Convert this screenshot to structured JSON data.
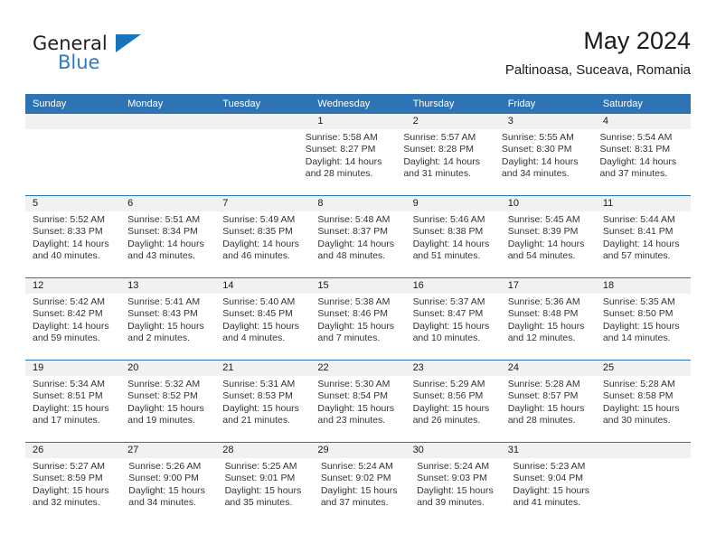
{
  "brand": {
    "name_top": "General",
    "name_bottom": "Blue",
    "triangle_color": "#1874bb",
    "text_color": "#231f20",
    "blue_text_color": "#2b7cc0"
  },
  "header": {
    "title": "May 2024",
    "subtitle": "Paltinoasa, Suceava, Romania"
  },
  "theme": {
    "header_blue": "#2e74b5",
    "daynum_band": "#f1f1f1",
    "text": "#333333"
  },
  "weekdays": [
    "Sunday",
    "Monday",
    "Tuesday",
    "Wednesday",
    "Thursday",
    "Friday",
    "Saturday"
  ],
  "labels": {
    "sunrise": "Sunrise:",
    "sunset": "Sunset:",
    "daylight": "Daylight:"
  },
  "weeks": [
    [
      {
        "day": "",
        "empty": true
      },
      {
        "day": "",
        "empty": true
      },
      {
        "day": "",
        "empty": true
      },
      {
        "day": "1",
        "sunrise": "Sunrise: 5:58 AM",
        "sunset": "Sunset: 8:27 PM",
        "daylight1": "Daylight: 14 hours",
        "daylight2": "and 28 minutes."
      },
      {
        "day": "2",
        "sunrise": "Sunrise: 5:57 AM",
        "sunset": "Sunset: 8:28 PM",
        "daylight1": "Daylight: 14 hours",
        "daylight2": "and 31 minutes."
      },
      {
        "day": "3",
        "sunrise": "Sunrise: 5:55 AM",
        "sunset": "Sunset: 8:30 PM",
        "daylight1": "Daylight: 14 hours",
        "daylight2": "and 34 minutes."
      },
      {
        "day": "4",
        "sunrise": "Sunrise: 5:54 AM",
        "sunset": "Sunset: 8:31 PM",
        "daylight1": "Daylight: 14 hours",
        "daylight2": "and 37 minutes."
      }
    ],
    [
      {
        "day": "5",
        "sunrise": "Sunrise: 5:52 AM",
        "sunset": "Sunset: 8:33 PM",
        "daylight1": "Daylight: 14 hours",
        "daylight2": "and 40 minutes."
      },
      {
        "day": "6",
        "sunrise": "Sunrise: 5:51 AM",
        "sunset": "Sunset: 8:34 PM",
        "daylight1": "Daylight: 14 hours",
        "daylight2": "and 43 minutes."
      },
      {
        "day": "7",
        "sunrise": "Sunrise: 5:49 AM",
        "sunset": "Sunset: 8:35 PM",
        "daylight1": "Daylight: 14 hours",
        "daylight2": "and 46 minutes."
      },
      {
        "day": "8",
        "sunrise": "Sunrise: 5:48 AM",
        "sunset": "Sunset: 8:37 PM",
        "daylight1": "Daylight: 14 hours",
        "daylight2": "and 48 minutes."
      },
      {
        "day": "9",
        "sunrise": "Sunrise: 5:46 AM",
        "sunset": "Sunset: 8:38 PM",
        "daylight1": "Daylight: 14 hours",
        "daylight2": "and 51 minutes."
      },
      {
        "day": "10",
        "sunrise": "Sunrise: 5:45 AM",
        "sunset": "Sunset: 8:39 PM",
        "daylight1": "Daylight: 14 hours",
        "daylight2": "and 54 minutes."
      },
      {
        "day": "11",
        "sunrise": "Sunrise: 5:44 AM",
        "sunset": "Sunset: 8:41 PM",
        "daylight1": "Daylight: 14 hours",
        "daylight2": "and 57 minutes."
      }
    ],
    [
      {
        "day": "12",
        "sunrise": "Sunrise: 5:42 AM",
        "sunset": "Sunset: 8:42 PM",
        "daylight1": "Daylight: 14 hours",
        "daylight2": "and 59 minutes."
      },
      {
        "day": "13",
        "sunrise": "Sunrise: 5:41 AM",
        "sunset": "Sunset: 8:43 PM",
        "daylight1": "Daylight: 15 hours",
        "daylight2": "and 2 minutes."
      },
      {
        "day": "14",
        "sunrise": "Sunrise: 5:40 AM",
        "sunset": "Sunset: 8:45 PM",
        "daylight1": "Daylight: 15 hours",
        "daylight2": "and 4 minutes."
      },
      {
        "day": "15",
        "sunrise": "Sunrise: 5:38 AM",
        "sunset": "Sunset: 8:46 PM",
        "daylight1": "Daylight: 15 hours",
        "daylight2": "and 7 minutes."
      },
      {
        "day": "16",
        "sunrise": "Sunrise: 5:37 AM",
        "sunset": "Sunset: 8:47 PM",
        "daylight1": "Daylight: 15 hours",
        "daylight2": "and 10 minutes."
      },
      {
        "day": "17",
        "sunrise": "Sunrise: 5:36 AM",
        "sunset": "Sunset: 8:48 PM",
        "daylight1": "Daylight: 15 hours",
        "daylight2": "and 12 minutes."
      },
      {
        "day": "18",
        "sunrise": "Sunrise: 5:35 AM",
        "sunset": "Sunset: 8:50 PM",
        "daylight1": "Daylight: 15 hours",
        "daylight2": "and 14 minutes."
      }
    ],
    [
      {
        "day": "19",
        "sunrise": "Sunrise: 5:34 AM",
        "sunset": "Sunset: 8:51 PM",
        "daylight1": "Daylight: 15 hours",
        "daylight2": "and 17 minutes."
      },
      {
        "day": "20",
        "sunrise": "Sunrise: 5:32 AM",
        "sunset": "Sunset: 8:52 PM",
        "daylight1": "Daylight: 15 hours",
        "daylight2": "and 19 minutes."
      },
      {
        "day": "21",
        "sunrise": "Sunrise: 5:31 AM",
        "sunset": "Sunset: 8:53 PM",
        "daylight1": "Daylight: 15 hours",
        "daylight2": "and 21 minutes."
      },
      {
        "day": "22",
        "sunrise": "Sunrise: 5:30 AM",
        "sunset": "Sunset: 8:54 PM",
        "daylight1": "Daylight: 15 hours",
        "daylight2": "and 23 minutes."
      },
      {
        "day": "23",
        "sunrise": "Sunrise: 5:29 AM",
        "sunset": "Sunset: 8:56 PM",
        "daylight1": "Daylight: 15 hours",
        "daylight2": "and 26 minutes."
      },
      {
        "day": "24",
        "sunrise": "Sunrise: 5:28 AM",
        "sunset": "Sunset: 8:57 PM",
        "daylight1": "Daylight: 15 hours",
        "daylight2": "and 28 minutes."
      },
      {
        "day": "25",
        "sunrise": "Sunrise: 5:28 AM",
        "sunset": "Sunset: 8:58 PM",
        "daylight1": "Daylight: 15 hours",
        "daylight2": "and 30 minutes."
      }
    ],
    [
      {
        "day": "26",
        "sunrise": "Sunrise: 5:27 AM",
        "sunset": "Sunset: 8:59 PM",
        "daylight1": "Daylight: 15 hours",
        "daylight2": "and 32 minutes."
      },
      {
        "day": "27",
        "sunrise": "Sunrise: 5:26 AM",
        "sunset": "Sunset: 9:00 PM",
        "daylight1": "Daylight: 15 hours",
        "daylight2": "and 34 minutes."
      },
      {
        "day": "28",
        "sunrise": "Sunrise: 5:25 AM",
        "sunset": "Sunset: 9:01 PM",
        "daylight1": "Daylight: 15 hours",
        "daylight2": "and 35 minutes."
      },
      {
        "day": "29",
        "sunrise": "Sunrise: 5:24 AM",
        "sunset": "Sunset: 9:02 PM",
        "daylight1": "Daylight: 15 hours",
        "daylight2": "and 37 minutes."
      },
      {
        "day": "30",
        "sunrise": "Sunrise: 5:24 AM",
        "sunset": "Sunset: 9:03 PM",
        "daylight1": "Daylight: 15 hours",
        "daylight2": "and 39 minutes."
      },
      {
        "day": "31",
        "sunrise": "Sunrise: 5:23 AM",
        "sunset": "Sunset: 9:04 PM",
        "daylight1": "Daylight: 15 hours",
        "daylight2": "and 41 minutes."
      },
      {
        "day": "",
        "empty": true
      }
    ]
  ]
}
